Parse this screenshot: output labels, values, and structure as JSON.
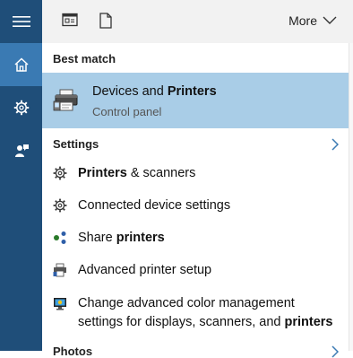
{
  "topbar": {
    "more_label": "More"
  },
  "sections": {
    "best_match": "Best match",
    "settings": "Settings",
    "photos": "Photos"
  },
  "best_match": {
    "title_prefix": "Devices and ",
    "title_bold": "Printers",
    "subtitle": "Control panel"
  },
  "settings_items": [
    {
      "bold": "Printers",
      "rest": " & scanners",
      "icon": "gear-icon"
    },
    {
      "bold": "",
      "rest": "Connected device settings",
      "icon": "gear-icon"
    },
    {
      "prefix": "Share ",
      "bold": "printers",
      "icon": "share-icon"
    },
    {
      "bold": "",
      "rest": "Advanced printer setup",
      "icon": "printer-network-icon"
    }
  ],
  "color_item": {
    "line1": "Change advanced color management",
    "line2_prefix": "settings for displays, scanners, and ",
    "line2_bold": "printers",
    "icon": "monitor-color-icon"
  },
  "colors": {
    "rail": "#1f4e79",
    "home_selected": "#3a7ab3",
    "best_bg": "#a9cde7"
  }
}
